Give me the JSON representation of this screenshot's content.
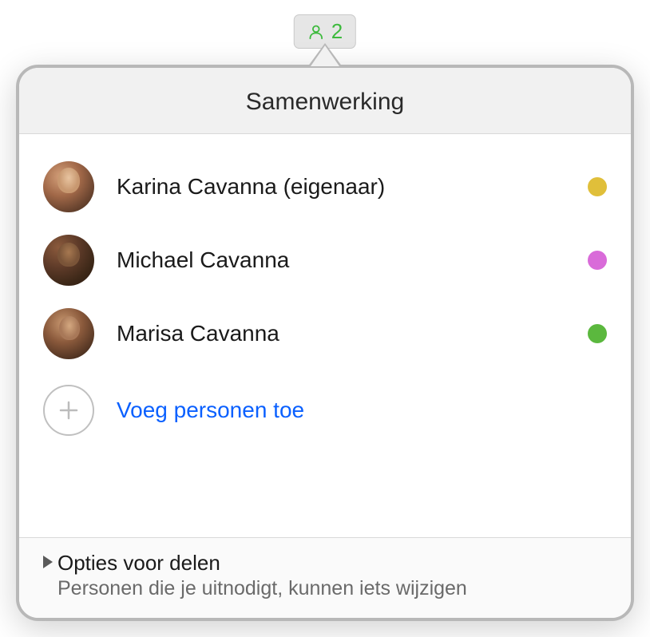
{
  "collab_button": {
    "count": "2",
    "icon_color": "#3dba3d"
  },
  "popover": {
    "title": "Samenwerking",
    "participants": [
      {
        "name": "Karina Cavanna (eigenaar)",
        "dot_color": "#e0bf3a"
      },
      {
        "name": "Michael Cavanna",
        "dot_color": "#d96bd9"
      },
      {
        "name": "Marisa Cavanna",
        "dot_color": "#5bb83e"
      }
    ],
    "add_label": "Voeg personen toe",
    "footer": {
      "title": "Opties voor delen",
      "subtitle": "Personen die je uitnodigt, kunnen iets wijzigen"
    }
  }
}
